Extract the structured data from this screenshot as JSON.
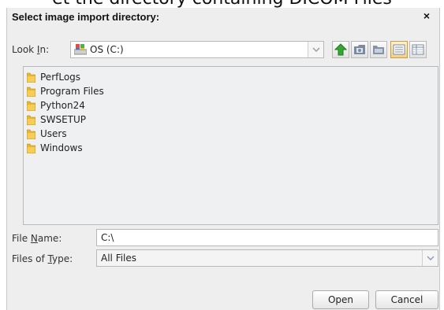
{
  "background_caption": "et the directory containing DICOM Files",
  "dialog": {
    "title": "Select image import directory:",
    "close_label": "×"
  },
  "look_in": {
    "label_prefix": "Look ",
    "label_mnemonic": "I",
    "label_suffix": "n:",
    "value": "OS (C:)",
    "value_icon": "drive-icon"
  },
  "toolbar": {
    "buttons": [
      {
        "name": "up-one-level",
        "icon": "up-arrow-icon"
      },
      {
        "name": "desktop",
        "icon": "desktop-icon"
      },
      {
        "name": "create-new-folder",
        "icon": "new-folder-icon"
      },
      {
        "name": "list-view",
        "icon": "list-view-icon",
        "active": true
      },
      {
        "name": "details-view",
        "icon": "details-view-icon"
      }
    ]
  },
  "files": [
    {
      "name": "PerfLogs",
      "icon": "folder-icon"
    },
    {
      "name": "Program Files",
      "icon": "folder-icon"
    },
    {
      "name": "Python24",
      "icon": "folder-icon"
    },
    {
      "name": "SWSETUP",
      "icon": "folder-icon"
    },
    {
      "name": "Users",
      "icon": "folder-icon"
    },
    {
      "name": "Windows",
      "icon": "folder-icon"
    }
  ],
  "file_name": {
    "label_prefix": "File ",
    "label_mnemonic": "N",
    "label_suffix": "ame:",
    "value": "C:\\"
  },
  "file_type": {
    "label_prefix": "Files of ",
    "label_mnemonic": "T",
    "label_suffix": "ype:",
    "value": "All Files"
  },
  "buttons": {
    "open": "Open",
    "cancel": "Cancel"
  },
  "colors": {
    "folder": "#e8b730",
    "up_arrow": "#39a535",
    "dialog_bg": "#eeeeee",
    "list_bg": "#eef0f2"
  }
}
